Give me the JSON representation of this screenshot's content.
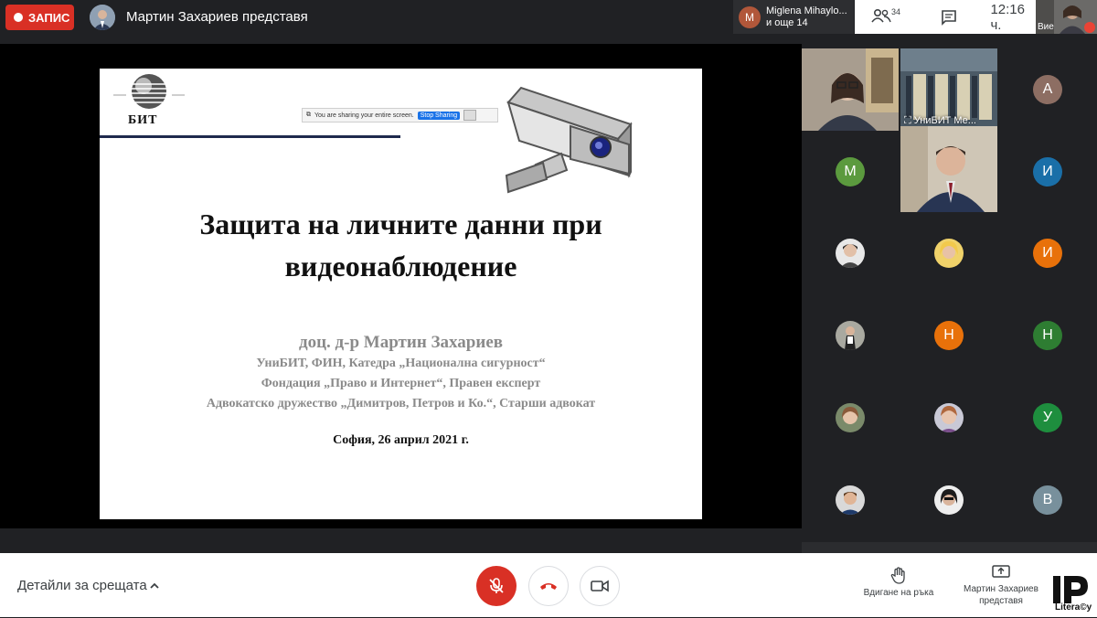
{
  "topbar": {
    "record_label": "ЗАПИС",
    "presenter_title": "Мартин Захариев представя",
    "speaker": {
      "initial": "M",
      "name": "Miglena Mihaylo...",
      "more": "и още 14"
    },
    "participants_count": "34",
    "time": "12:16 ч.",
    "self_label": "Вие"
  },
  "sharing_bar": {
    "text": "You are sharing your entire screen.",
    "stop_label": "Stop Sharing"
  },
  "slide": {
    "logo_text": "БИТ",
    "title_line1": "Защита на личните данни при",
    "title_line2": "видеонаблюдение",
    "author": "доц. д-р Мартин Захариев",
    "affiliations": [
      "УниБИТ, ФИН, Катедра „Национална сигурност“",
      "Фондация „Право и Интернет“, Правен експерт",
      "Адвокатско дружество „Димитров, Петров и Ко.“, Старши адвокат"
    ],
    "date": "София, 26 април 2021 г."
  },
  "grid": {
    "tile_label": "УниБИТ Ме...",
    "avatars": [
      {
        "initial": "А",
        "color": "#8d6e63"
      },
      {
        "initial": "М",
        "color": "#5b9a3e"
      },
      {
        "initial": "И",
        "color": "#1a6fa8"
      },
      {
        "initial": "И",
        "color": "#e8710a"
      },
      {
        "initial": "Н",
        "color": "#e8710a"
      },
      {
        "initial": "Н",
        "color": "#2e7d32"
      },
      {
        "initial": "У",
        "color": "#1e8e3e"
      },
      {
        "initial": "В",
        "color": "#78909c"
      }
    ]
  },
  "bottombar": {
    "details_label": "Детайли за срещата",
    "raise_hand_label": "Вдигане на ръка",
    "presenting_line1": "Мартин Захариев",
    "presenting_line2": "представя",
    "brand_text": "Litera©y"
  }
}
